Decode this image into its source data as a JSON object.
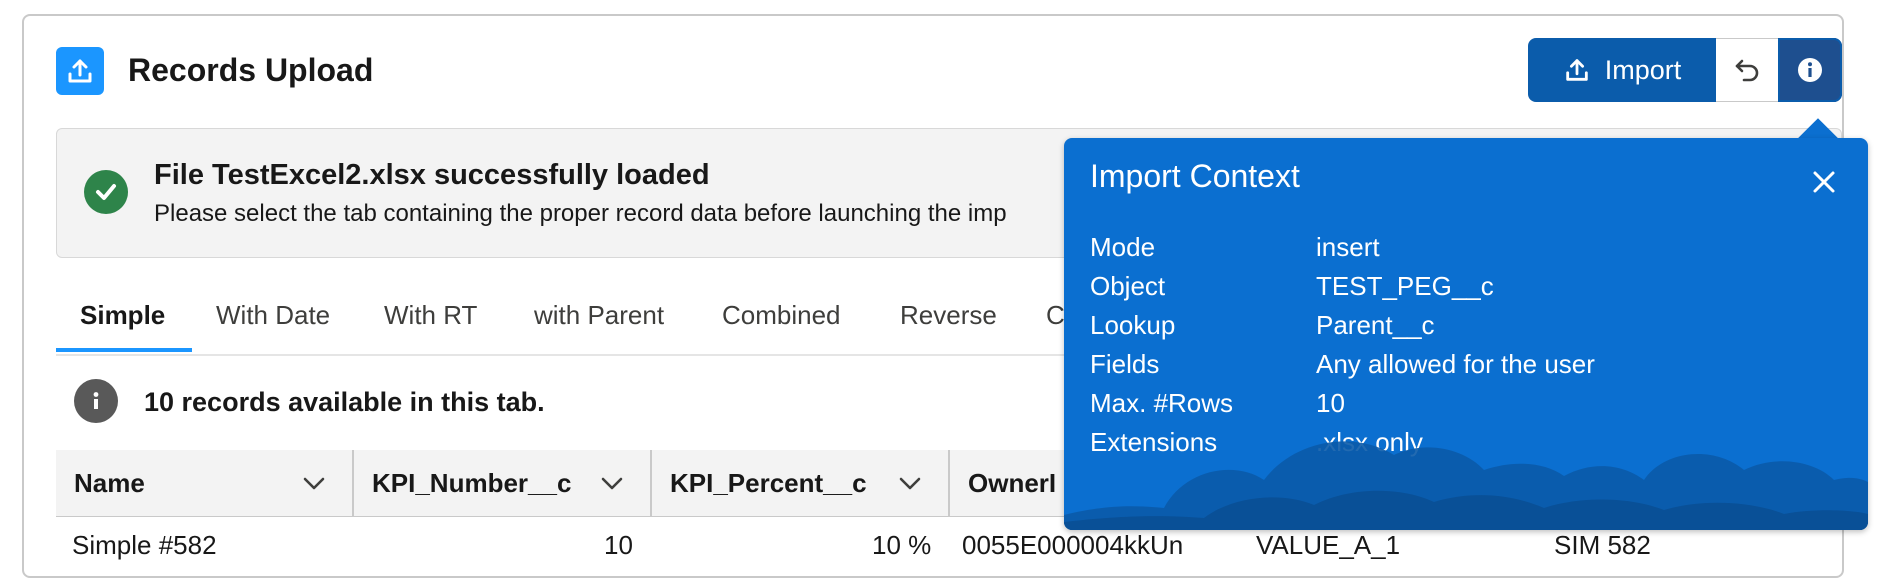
{
  "header": {
    "title": "Records Upload",
    "icon": "upload-icon",
    "import_label": "Import"
  },
  "alert": {
    "title": "File TestExcel2.xlsx successfully loaded",
    "message": "Please select the tab containing the proper record data before launching the imp"
  },
  "tabs": [
    {
      "label": "Simple",
      "active": true
    },
    {
      "label": "With Date"
    },
    {
      "label": "With RT"
    },
    {
      "label": "with Parent"
    },
    {
      "label": "Combined"
    },
    {
      "label": "Reverse"
    },
    {
      "label": "Co"
    }
  ],
  "records_info": "10 records available in this tab.",
  "table": {
    "columns": [
      "Name",
      "KPI_Number__c",
      "KPI_Percent__c",
      "OwnerI"
    ],
    "rows": [
      [
        "Simple #582",
        "10",
        "10 %",
        "0055E000004kkUn",
        "VALUE_A_1",
        "SIM 582"
      ]
    ]
  },
  "popover": {
    "title": "Import Context",
    "rows": [
      {
        "key": "Mode",
        "value": "insert"
      },
      {
        "key": "Object",
        "value": "TEST_PEG__c"
      },
      {
        "key": "Lookup",
        "value": "Parent__c"
      },
      {
        "key": "Fields",
        "value": "Any allowed for the user"
      },
      {
        "key": "Max. #Rows",
        "value": "10"
      },
      {
        "key": "Extensions",
        "value": ".xlsx only"
      }
    ]
  },
  "colors": {
    "brand": "#0b5cab",
    "popover": "#0b6fd0",
    "success": "#2e844a",
    "tab_active": "#1b96ff"
  }
}
